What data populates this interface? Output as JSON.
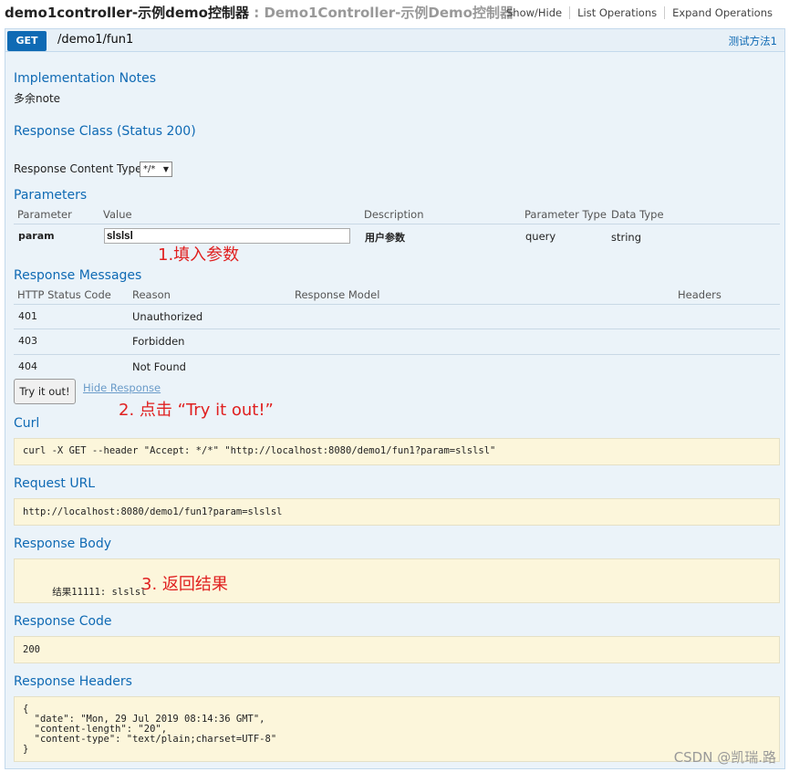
{
  "header": {
    "controller_name": "demo1controller-示例demo控制器",
    "separator": ":",
    "controller_desc": "Demo1Controller-示例Demo控制器",
    "links": [
      "Show/Hide",
      "List Operations",
      "Expand Operations"
    ]
  },
  "operation": {
    "method": "GET",
    "path": "/demo1/fun1",
    "summary": "测试方法1"
  },
  "implementation": {
    "title": "Implementation Notes",
    "note": "多余note"
  },
  "response_class": {
    "title": "Response Class (Status 200)"
  },
  "content_type": {
    "label": "Response Content Type",
    "value": "*/*"
  },
  "parameters": {
    "title": "Parameters",
    "columns": [
      "Parameter",
      "Value",
      "Description",
      "Parameter Type",
      "Data Type"
    ],
    "rows": [
      {
        "name": "param",
        "value": "slslsl",
        "description": "用户参数",
        "type": "query",
        "data_type": "string"
      }
    ]
  },
  "response_messages": {
    "title": "Response Messages",
    "columns": [
      "HTTP Status Code",
      "Reason",
      "Response Model",
      "Headers"
    ],
    "rows": [
      {
        "code": "401",
        "reason": "Unauthorized"
      },
      {
        "code": "403",
        "reason": "Forbidden"
      },
      {
        "code": "404",
        "reason": "Not Found"
      }
    ]
  },
  "actions": {
    "try_label": "Try it out!",
    "hide_label": "Hide Response"
  },
  "annotations": {
    "step1": "1.填入参数",
    "step2": "2. 点击 “Try it out!”",
    "step3": "3. 返回结果"
  },
  "curl": {
    "title": "Curl",
    "command": "curl -X GET --header \"Accept: */*\" \"http://localhost:8080/demo1/fun1?param=slslsl\""
  },
  "request_url": {
    "title": "Request URL",
    "value": "http://localhost:8080/demo1/fun1?param=slslsl"
  },
  "response_body": {
    "title": "Response Body",
    "value": "结果11111: slslsl"
  },
  "response_code": {
    "title": "Response Code",
    "value": "200"
  },
  "response_headers": {
    "title": "Response Headers",
    "value": "{\n  \"date\": \"Mon, 29 Jul 2019 08:14:36 GMT\",\n  \"content-length\": \"20\",\n  \"content-type\": \"text/plain;charset=UTF-8\"\n}"
  },
  "watermark": "CSDN @凯瑞.路"
}
